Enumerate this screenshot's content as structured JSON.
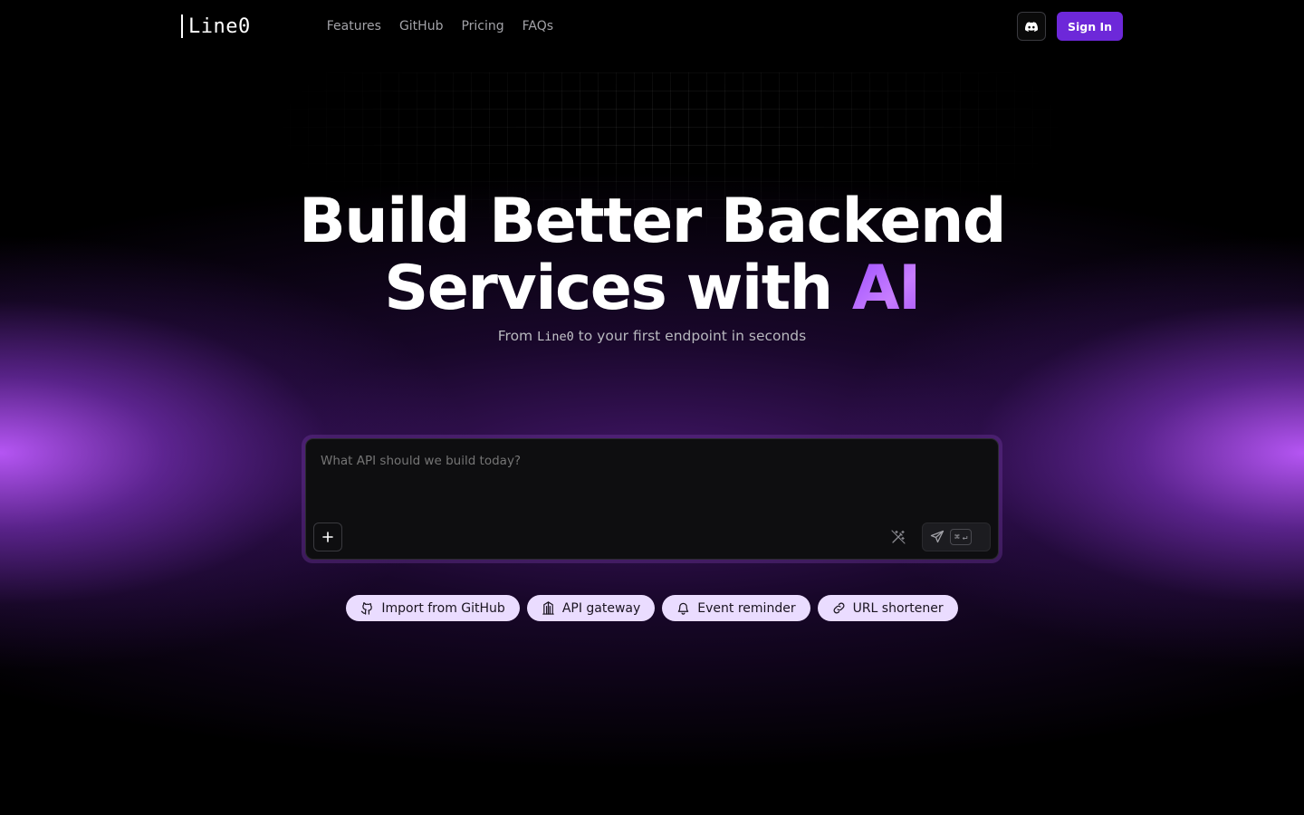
{
  "header": {
    "logo_text": "Line0",
    "nav": [
      {
        "label": "Features"
      },
      {
        "label": "GitHub"
      },
      {
        "label": "Pricing"
      },
      {
        "label": "FAQs"
      }
    ],
    "discord_icon": "discord-icon",
    "signin_label": "Sign In"
  },
  "hero": {
    "title_line1": "Build Better Backend",
    "title_line2_prefix": "Services with",
    "title_highlight": "AI",
    "subtitle_prefix": "From",
    "subtitle_code": "Line0",
    "subtitle_suffix": "to your first endpoint in seconds"
  },
  "prompt": {
    "placeholder": "What API should we build today?",
    "add_icon": "plus-icon",
    "enhance_icon": "magic-wand-icon",
    "send_icon": "send-icon",
    "shortcut_symbol": "⌘",
    "shortcut_enter": "↵"
  },
  "suggestions": [
    {
      "label": "Import from GitHub",
      "icon": "github-icon"
    },
    {
      "label": "API gateway",
      "icon": "gateway-icon"
    },
    {
      "label": "Event reminder",
      "icon": "bell-icon"
    },
    {
      "label": "URL shortener",
      "icon": "link-icon"
    }
  ],
  "colors": {
    "accent": "#6d28d9",
    "chip_bg": "#eadcff",
    "glow": "#be5aff"
  }
}
